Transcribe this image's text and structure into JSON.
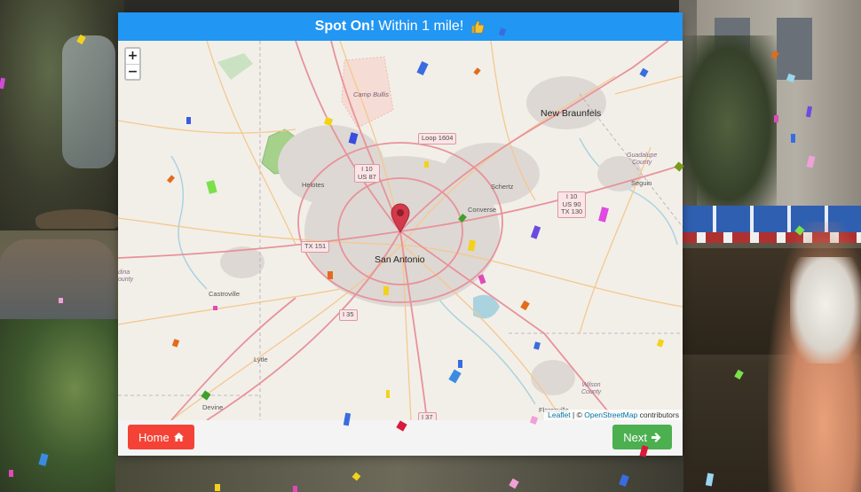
{
  "result": {
    "headline": "Spot On!",
    "detail": "Within 1 mile!",
    "icon": "thumbs-up-icon"
  },
  "map": {
    "zoom_in": "+",
    "zoom_out": "−",
    "attribution": {
      "leaflet": "Leaflet",
      "separator": " | © ",
      "osm": "OpenStreetMap",
      "suffix": " contributors"
    },
    "labels": {
      "san_antonio": "San Antonio",
      "new_braunfels": "New Braunfels",
      "schertz": "Schertz",
      "converse": "Converse",
      "helotes": "Helotes",
      "castroville": "Castroville",
      "lytle": "Lytle",
      "devine": "Devine",
      "floresville": "Floresville",
      "seguin": "Seguin",
      "camp_bullis": "Camp Bullis",
      "guadalupe_county": "Guadalupe\nCounty",
      "wilson_county": "Wilson\nCounty",
      "medina_county": "dina\nounty"
    },
    "shields": {
      "loop1604": "Loop 1604",
      "i10_us87": "I 10\nUS 87",
      "i10_us90_tx130": "I 10\nUS 90\nTX 130",
      "tx151": "TX 151",
      "i35": "I 35",
      "i37": "I 37"
    },
    "pin_color": "#d33a4a"
  },
  "footer": {
    "home_label": "Home",
    "next_label": "Next",
    "home_icon": "home-icon",
    "next_icon": "arrow-right-icon"
  },
  "colors": {
    "header": "#2196f3",
    "home_button": "#f44336",
    "next_button": "#4caf50"
  }
}
